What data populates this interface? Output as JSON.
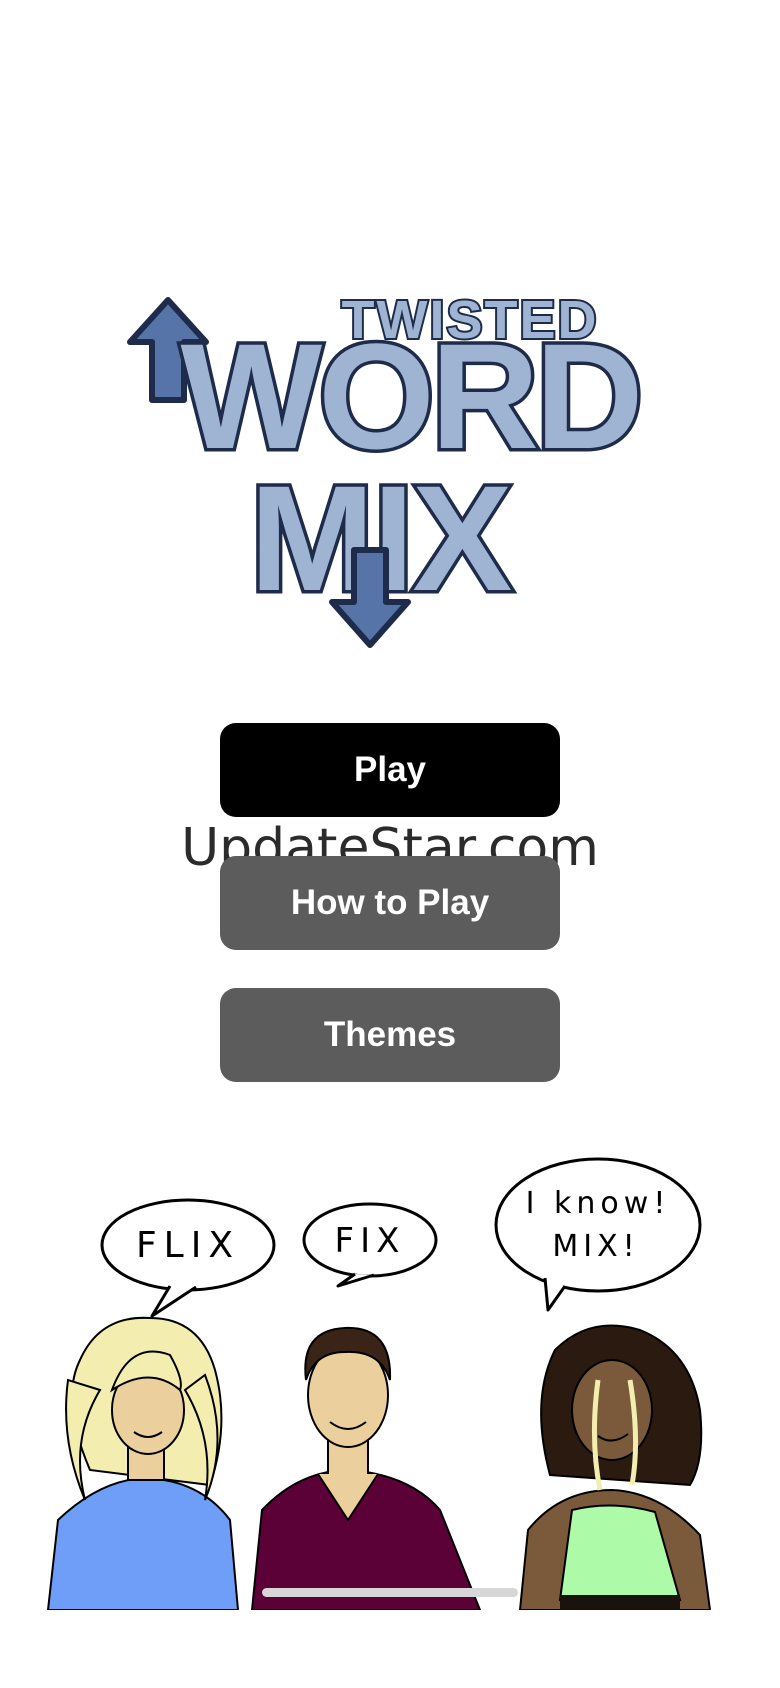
{
  "logo": {
    "line1": "TWISTED",
    "line2": "WORD",
    "line3": "MIX",
    "colors": {
      "fill": "#9eb4d2",
      "dark_fill": "#5674a8",
      "outline": "#1e2b4a"
    }
  },
  "menu": {
    "play_label": "Play",
    "how_to_play_label": "How to Play",
    "themes_label": "Themes"
  },
  "watermark": "UpdateStar.com",
  "characters": [
    {
      "speech": "FLIX",
      "shirt_color": "#6f9ef8",
      "hair_color": "#f3eeb0"
    },
    {
      "speech": "FIX",
      "shirt_color": "#5c0038",
      "hair_color": "#3a2418"
    },
    {
      "speech_line1": "I know!",
      "speech_line2": "MIX!",
      "shirt_color": "#adfba8",
      "hair_color": "#2b1a10"
    }
  ]
}
